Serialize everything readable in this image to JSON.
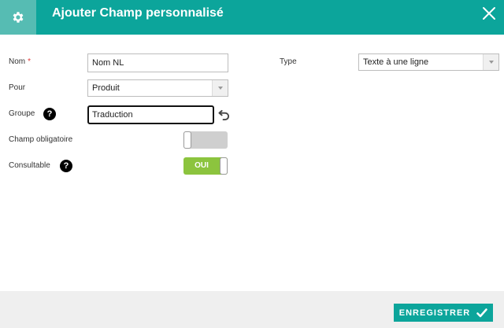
{
  "dialog": {
    "title": "Ajouter Champ personnalisé",
    "header_icon": "gear-icon",
    "close_icon": "close-icon"
  },
  "form": {
    "nom": {
      "label": "Nom",
      "required_mark": "*",
      "value": "Nom NL"
    },
    "pour": {
      "label": "Pour",
      "selected": "Produit"
    },
    "groupe": {
      "label": "Groupe",
      "value": "Traduction",
      "help": "?"
    },
    "champ_obligatoire": {
      "label": "Champ obligatoire",
      "state": "off"
    },
    "consultable": {
      "label": "Consultable",
      "state": "on",
      "on_label": "OUI",
      "help": "?"
    },
    "type": {
      "label": "Type",
      "selected": "Texte à une ligne"
    }
  },
  "footer": {
    "save_label": "ENREGISTRER"
  },
  "colors": {
    "header_bg": "#0ca59b",
    "icon_box_bg": "#56bcb3",
    "toggle_on": "#8cc43e",
    "toggle_off": "#cfcfcf",
    "required": "#e03a3a"
  }
}
